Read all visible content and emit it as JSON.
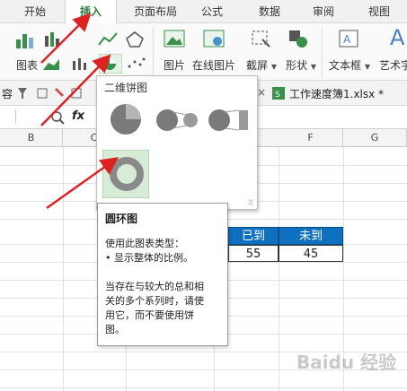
{
  "tabs": [
    {
      "label": "开始",
      "active": false
    },
    {
      "label": "插入",
      "active": true
    },
    {
      "label": "页面布局",
      "active": false
    },
    {
      "label": "公式",
      "active": false
    },
    {
      "label": "数据",
      "active": false
    },
    {
      "label": "审阅",
      "active": false
    },
    {
      "label": "视图",
      "active": false
    }
  ],
  "ribbon": {
    "chart_label": "图表",
    "picture_label": "图片",
    "online_picture_label": "在线图片",
    "screenshot_label": "截屏",
    "shapes_label": "形状",
    "textbox_label": "文本框",
    "art_label": "艺术字"
  },
  "docrow": {
    "left_char": "容",
    "file_tab": "工作速度簿1.xlsx *",
    "close": "×"
  },
  "formula": {
    "fx": "fx"
  },
  "columns": [
    "B",
    "C",
    "F",
    "G"
  ],
  "dropdown": {
    "title": "二维饼图"
  },
  "tooltip": {
    "title": "圆环图",
    "line1": "使用此图表类型：",
    "line2": "• 显示整体的比例。",
    "line3": "当存在与较大的总和相",
    "line4": "关的多个系列时，请使",
    "line5": "用它，而不要使用饼",
    "line6": "图。"
  },
  "table": {
    "headers": [
      "已到",
      "未到"
    ],
    "values": [
      "55",
      "45"
    ]
  },
  "watermark": "Baidu 经验"
}
